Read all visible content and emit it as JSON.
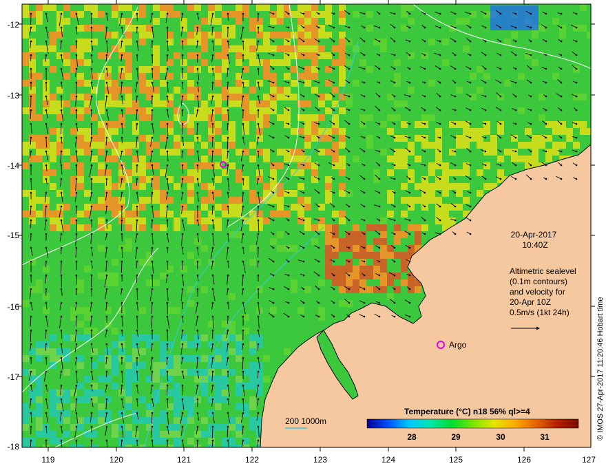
{
  "map": {
    "x_ticks": [
      "119",
      "120",
      "121",
      "122",
      "123",
      "124",
      "125",
      "126",
      "127"
    ],
    "y_ticks": [
      "-12",
      "-13",
      "-14",
      "-15",
      "-16",
      "-17",
      "-18"
    ],
    "colors": {
      "land": "#f6c8a0",
      "sea_mid": "#3cc83c",
      "sea_warm": "#c8dc1e",
      "sea_hot": "#e69628",
      "sea_cool": "#28c8a0",
      "contour_sealevel": "#ffffff",
      "contour_depth": "#37c8e1",
      "argo_marker": "#e600e6"
    }
  },
  "annotations": {
    "date": "20-Apr-2017",
    "time": "10:40Z",
    "desc_line1": "Altimetric sealevel",
    "desc_line2": "(0.1m contours)",
    "desc_line3": "and velocity for",
    "desc_line4": "20-Apr 10Z",
    "desc_line5": "0.5m/s (1kt 24h)",
    "argo_label": "Argo",
    "depth_legend": "200  1000m"
  },
  "colorbar": {
    "title": "Temperature (°C) n18 56% ql>=4",
    "ticks": [
      "28",
      "29",
      "30",
      "31"
    ],
    "stops": [
      "#000096",
      "#0050ff",
      "#00c8ff",
      "#00e6aa",
      "#00dc32",
      "#78e600",
      "#e6e600",
      "#ffaa00",
      "#e66400",
      "#b41e00",
      "#7a0a00"
    ]
  },
  "credit": "© IMOS 27-Apr-2017 11:20:46 Hobart time"
}
